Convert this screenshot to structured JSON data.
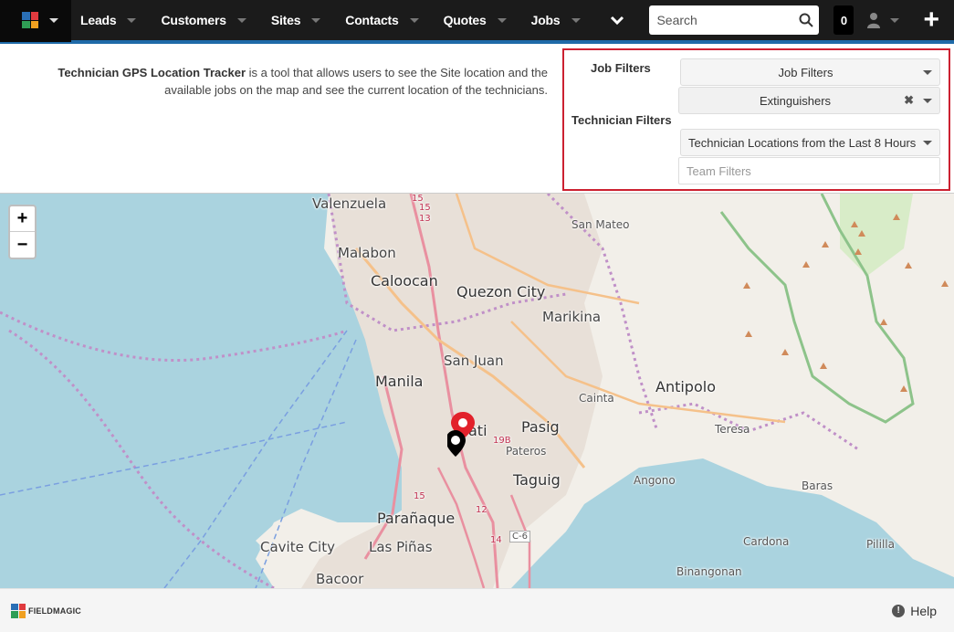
{
  "nav": {
    "items": [
      {
        "label": "Leads"
      },
      {
        "label": "Customers"
      },
      {
        "label": "Sites"
      },
      {
        "label": "Contacts"
      },
      {
        "label": "Quotes"
      },
      {
        "label": "Jobs"
      }
    ],
    "search_placeholder": "Search",
    "count": "0",
    "brand_colors": [
      "#2a6fb5",
      "#e03a3e",
      "#2f9e55",
      "#f0a020"
    ]
  },
  "intro": {
    "title": "Technician GPS Location Tracker",
    "text": " is a tool that allows users to see the Site location and the available jobs on the map and see the current location of the technicians."
  },
  "filters": {
    "job_filters_label": "Job Filters",
    "technician_filters_label": "Technician Filters",
    "job_filters_select": "Job Filters",
    "job_type_select": "Extinguishers",
    "technician_locations_select": "Technician Locations from the Last 8 Hours",
    "team_filters_placeholder": "Team Filters",
    "highlight_color": "#cc2131"
  },
  "map": {
    "zoom_in": "+",
    "zoom_out": "−",
    "labels": [
      "Valenzuela",
      "Malabon",
      "Caloocan",
      "Quezon City",
      "San Mateo",
      "Marikina",
      "San Juan",
      "Manila",
      "Antipolo",
      "Cainta",
      "Pasig",
      "Pateros",
      "Taguig",
      "Teresa",
      "Angono",
      "Parañaque",
      "Cavite City",
      "Las Piñas",
      "Baras",
      "Cardona",
      "Bacoor",
      "Binangonan",
      "Pililla",
      "ati"
    ],
    "road_numbers": [
      "15",
      "13",
      "15",
      "15",
      "12",
      "14",
      "C-6",
      "19B"
    ],
    "pin_count": "3"
  },
  "footer": {
    "logo_text": "FIELDMAGIC",
    "help_label": "Help"
  }
}
